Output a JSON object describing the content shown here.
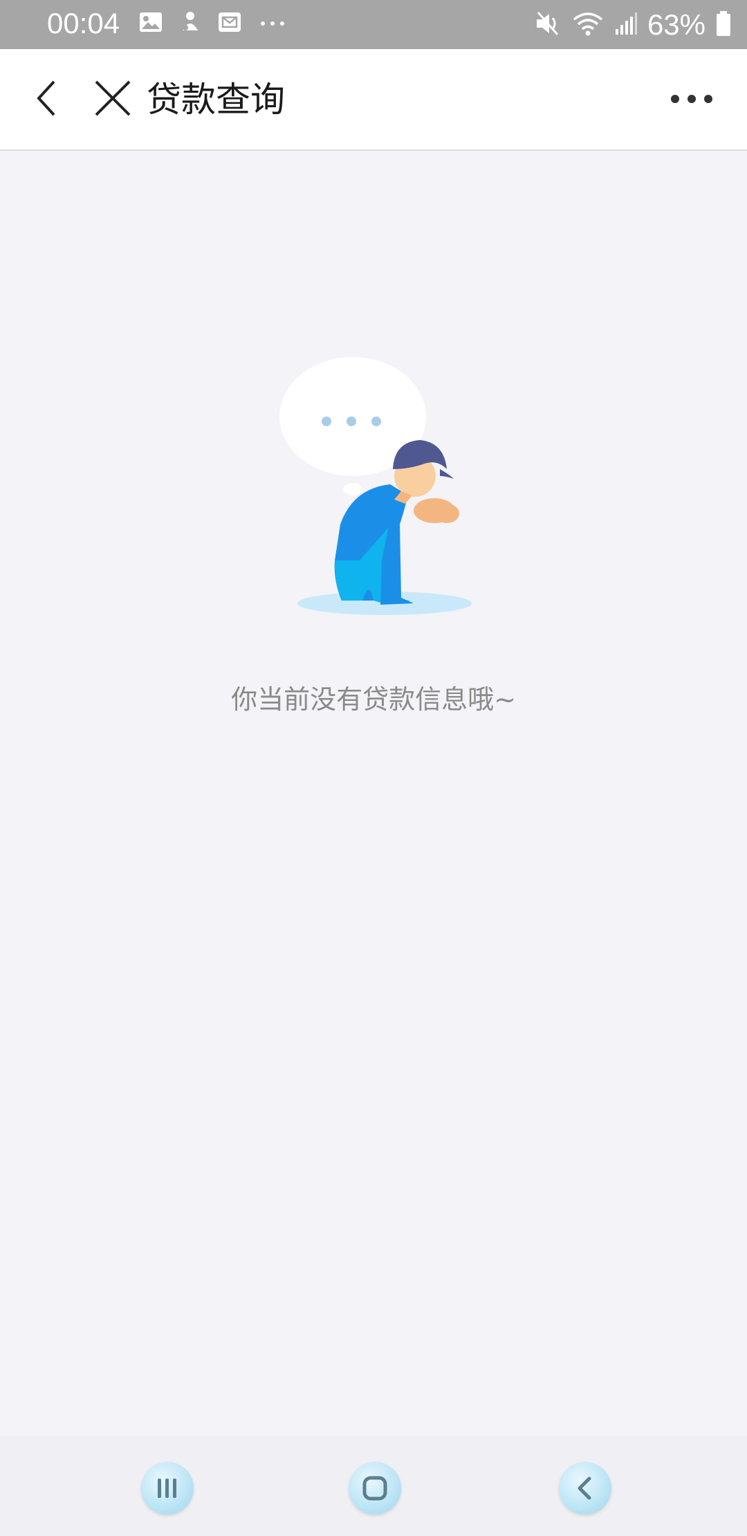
{
  "status_bar": {
    "time": "00:04",
    "battery": "63%",
    "left_icons": [
      "image-icon",
      "notification-icon",
      "mail-icon",
      "more-dots-icon"
    ],
    "right_icons": [
      "mute-icon",
      "wifi-icon",
      "signal-icon",
      "battery-icon"
    ]
  },
  "header": {
    "title": "贷款查询"
  },
  "empty_state": {
    "message": "你当前没有贷款信息哦~"
  },
  "colors": {
    "status_bar": "#a6a6a6",
    "page_background": "#f3f3f8",
    "accent_blue": "#1b8fe8",
    "bubble_dots": "#a8cde8"
  }
}
